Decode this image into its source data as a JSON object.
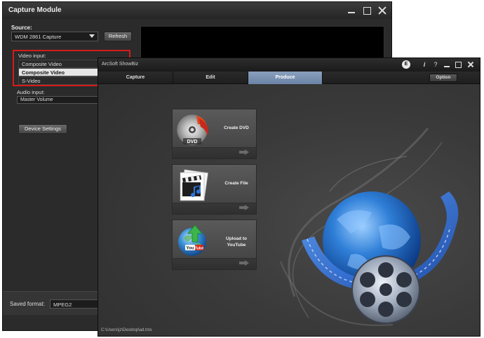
{
  "capture_module": {
    "title": "Capture Module",
    "source_label": "Source:",
    "source_value": "WDM 2861 Capture",
    "refresh_label": "Refresh",
    "video_input_label": "Video input:",
    "video_options": [
      {
        "label": "Composite Video",
        "selected": false
      },
      {
        "label": "Composite Video",
        "selected": true
      },
      {
        "label": "S-Video",
        "selected": false
      }
    ],
    "audio_input_label": "Audio input:",
    "audio_value": "Master Volume",
    "device_settings_label": "Device Settings",
    "saved_format_label": "Saved format:",
    "saved_format_value": "MPEG2",
    "highlight_color": "#d61a1a"
  },
  "showbiz": {
    "title": "ArcSoft ShowBiz",
    "e_badge": "E",
    "info_glyph": "i",
    "help_glyph": "?",
    "tabs": [
      {
        "label": "Capture",
        "active": false
      },
      {
        "label": "Edit",
        "active": false
      },
      {
        "label": "Produce",
        "active": true
      }
    ],
    "option_label": "Option",
    "actions": [
      {
        "label": "Create DVD",
        "icon": "dvd-disc-icon"
      },
      {
        "label": "Create File",
        "icon": "film-clapper-icon"
      },
      {
        "label": "Upload to YouTube",
        "icon": "youtube-globe-icon"
      }
    ],
    "status_path": "C:\\Users\\jz\\Desktop\\ad.tms",
    "active_tab_color": "#7590b2"
  }
}
